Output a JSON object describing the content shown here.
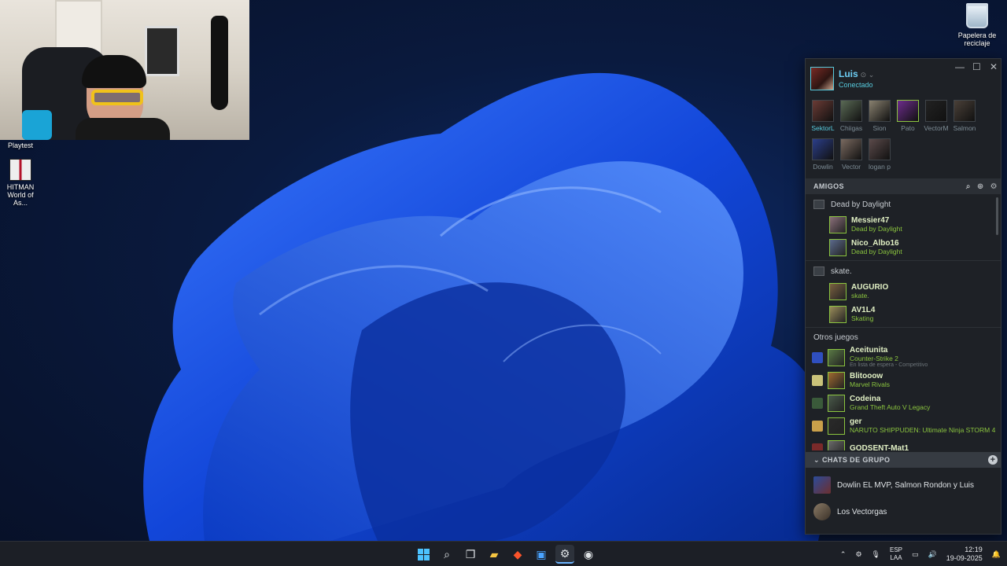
{
  "desktop": {
    "recycle_bin_label": "Papelera de reciclaje",
    "playtest_label": "Playtest",
    "hitman_label_line1": "HITMAN",
    "hitman_label_line2": "World of As..."
  },
  "steam": {
    "user": {
      "name": "Luis",
      "status": "Conectado"
    },
    "window_controls": {
      "minimize": "—",
      "maximize": "☐",
      "close": "✕"
    },
    "favorites": [
      {
        "name": "SektorL",
        "state": "online"
      },
      {
        "name": "Chiigas",
        "state": "offline"
      },
      {
        "name": "Sion",
        "state": "offline"
      },
      {
        "name": "Pato",
        "state": "ingame"
      },
      {
        "name": "VectorM",
        "state": "offline"
      },
      {
        "name": "Salmon",
        "state": "offline"
      },
      {
        "name": "Dowlin",
        "state": "offline"
      },
      {
        "name": "Vector",
        "state": "offline"
      },
      {
        "name": "logan p",
        "state": "offline"
      }
    ],
    "friends_header": "AMIGOS",
    "groups": [
      {
        "title": "Dead by Daylight",
        "friends": [
          {
            "name": "Messier47",
            "game": "Dead by Daylight"
          },
          {
            "name": "Nico_Albo16",
            "game": "Dead by Daylight"
          }
        ]
      },
      {
        "title": "skate.",
        "friends": [
          {
            "name": "AUGURIO",
            "game": "skate."
          },
          {
            "name": "AV1L4",
            "game": "Skating"
          }
        ]
      }
    ],
    "other_games_title": "Otros juegos",
    "other_games": [
      {
        "name": "Aceitunita",
        "game": "Counter-Strike 2",
        "sub": "En lista de espera - Competitivo"
      },
      {
        "name": "Blitooow",
        "game": "Marvel Rivals",
        "sub": ""
      },
      {
        "name": "Codeina",
        "game": "Grand Theft Auto V Legacy",
        "sub": ""
      },
      {
        "name": "ger",
        "game": "NARUTO SHIPPUDEN: Ultimate Ninja STORM 4",
        "sub": ""
      },
      {
        "name": "GODSENT-Mat1",
        "game": "",
        "sub": ""
      }
    ],
    "group_chats_header": "CHATS DE GRUPO",
    "group_chats": [
      {
        "name": "Dowlin EL MVP, Salmon Rondon y Luis"
      },
      {
        "name": "Los Vectorgas"
      }
    ],
    "colors": {
      "online": "#57cbde",
      "ingame": "#8bc53f",
      "bg": "#1e2126"
    }
  },
  "taskbar": {
    "apps": [
      "start-icon",
      "search-icon",
      "task-view-icon",
      "file-explorer-icon",
      "brave-icon",
      "photos-icon",
      "steam-icon",
      "obs-icon"
    ],
    "language_line1": "ESP",
    "language_line2": "LAA",
    "time": "12:19",
    "date": "19-09-2025"
  }
}
